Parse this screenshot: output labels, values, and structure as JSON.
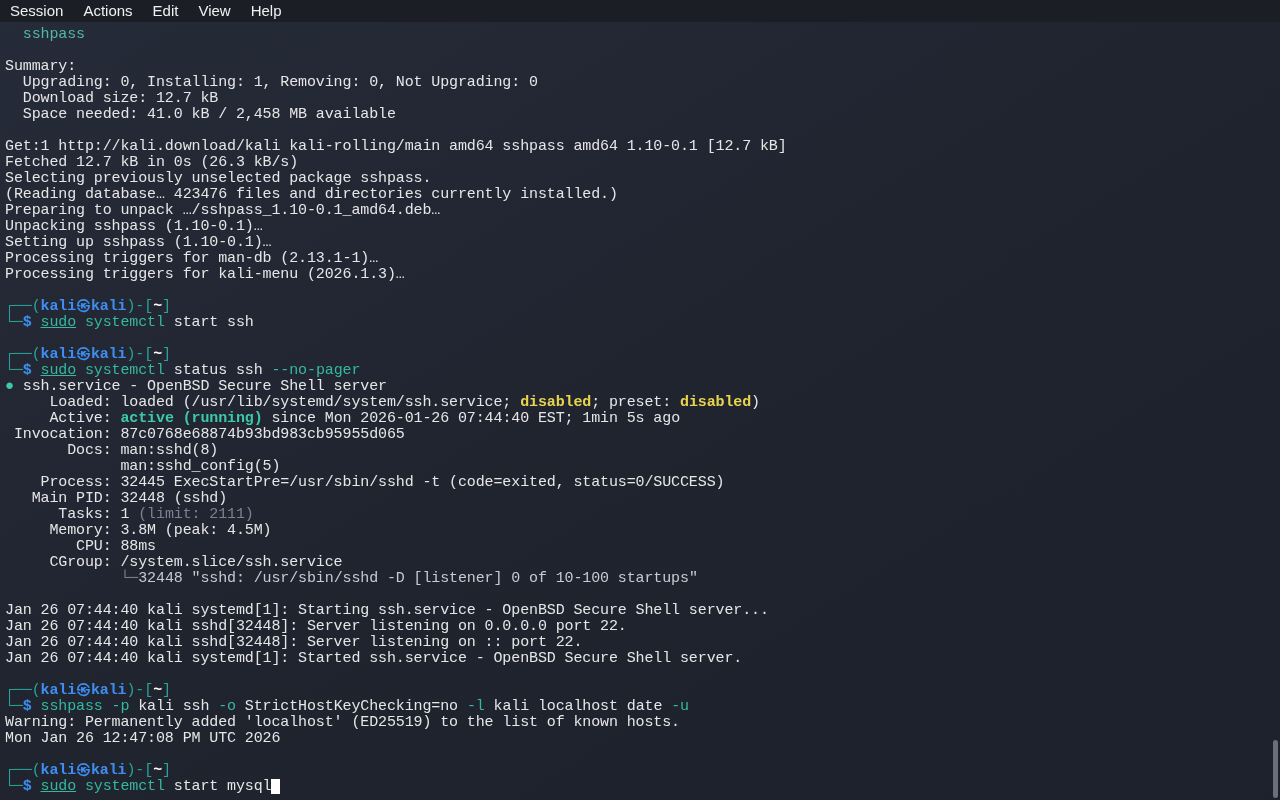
{
  "menu": [
    "Session",
    "Actions",
    "Edit",
    "View",
    "Help"
  ],
  "lines": [
    {
      "kind": "output",
      "segments": [
        {
          "text": "  sshpass",
          "kind": "pkg"
        }
      ]
    },
    {
      "kind": "blank"
    },
    {
      "kind": "output",
      "segments": [
        {
          "text": "Summary:",
          "kind": "plain"
        }
      ]
    },
    {
      "kind": "output",
      "segments": [
        {
          "text": "  Upgrading: 0, Installing: 1, Removing: 0, Not Upgrading: 0",
          "kind": "plain"
        }
      ]
    },
    {
      "kind": "output",
      "segments": [
        {
          "text": "  Download size: 12.7 kB",
          "kind": "plain"
        }
      ]
    },
    {
      "kind": "output",
      "segments": [
        {
          "text": "  Space needed: 41.0 kB / 2,458 MB available",
          "kind": "plain"
        }
      ]
    },
    {
      "kind": "blank"
    },
    {
      "kind": "output",
      "segments": [
        {
          "text": "Get:1 http://kali.download/kali kali-rolling/main amd64 sshpass amd64 1.10-0.1 [12.7 kB]",
          "kind": "plain"
        }
      ]
    },
    {
      "kind": "output",
      "segments": [
        {
          "text": "Fetched 12.7 kB in 0s (26.3 kB/s)",
          "kind": "plain"
        }
      ]
    },
    {
      "kind": "output",
      "segments": [
        {
          "text": "Selecting previously unselected package sshpass.",
          "kind": "plain"
        }
      ]
    },
    {
      "kind": "output",
      "segments": [
        {
          "text": "(Reading database… 423476 files and directories currently installed.)",
          "kind": "plain"
        }
      ]
    },
    {
      "kind": "output",
      "segments": [
        {
          "text": "Preparing to unpack …/sshpass_1.10-0.1_amd64.deb…",
          "kind": "plain"
        }
      ]
    },
    {
      "kind": "output",
      "segments": [
        {
          "text": "Unpacking sshpass (1.10-0.1)…",
          "kind": "plain"
        }
      ]
    },
    {
      "kind": "output",
      "segments": [
        {
          "text": "Setting up sshpass (1.10-0.1)…",
          "kind": "plain"
        }
      ]
    },
    {
      "kind": "output",
      "segments": [
        {
          "text": "Processing triggers for man-db (2.13.1-1)…",
          "kind": "plain"
        }
      ]
    },
    {
      "kind": "output",
      "segments": [
        {
          "text": "Processing triggers for kali-menu (2026.1.3)…",
          "kind": "plain"
        }
      ]
    },
    {
      "kind": "blank"
    },
    {
      "kind": "prompt",
      "segments": [
        {
          "text": "┌──(",
          "kind": "frame"
        },
        {
          "text": "kali㉿kali",
          "kind": "user"
        },
        {
          "text": ")-[",
          "kind": "frame"
        },
        {
          "text": "~",
          "kind": "home"
        },
        {
          "text": "]",
          "kind": "frame"
        }
      ]
    },
    {
      "kind": "command",
      "segments": [
        {
          "text": "└─",
          "kind": "frame"
        },
        {
          "text": "$ ",
          "kind": "user"
        },
        {
          "text": "sudo",
          "kind": "sudo"
        },
        {
          "text": " systemctl",
          "kind": "cmd"
        },
        {
          "text": " start ssh",
          "kind": "plain"
        }
      ]
    },
    {
      "kind": "blank"
    },
    {
      "kind": "prompt",
      "segments": [
        {
          "text": "┌──(",
          "kind": "frame"
        },
        {
          "text": "kali㉿kali",
          "kind": "user"
        },
        {
          "text": ")-[",
          "kind": "frame"
        },
        {
          "text": "~",
          "kind": "home"
        },
        {
          "text": "]",
          "kind": "frame"
        }
      ]
    },
    {
      "kind": "command",
      "segments": [
        {
          "text": "└─",
          "kind": "frame"
        },
        {
          "text": "$ ",
          "kind": "user"
        },
        {
          "text": "sudo",
          "kind": "sudo"
        },
        {
          "text": " systemctl",
          "kind": "cmd"
        },
        {
          "text": " status ssh ",
          "kind": "plain"
        },
        {
          "text": "--no-pager",
          "kind": "cmd"
        }
      ]
    },
    {
      "kind": "output",
      "segments": [
        {
          "text": "●",
          "kind": "ok"
        },
        {
          "text": " ssh.service - OpenBSD Secure Shell server",
          "kind": "plain"
        }
      ]
    },
    {
      "kind": "output",
      "segments": [
        {
          "text": "     Loaded: loaded (/usr/lib/systemd/system/ssh.service; ",
          "kind": "plain"
        },
        {
          "text": "disabled",
          "kind": "warn"
        },
        {
          "text": "; preset: ",
          "kind": "plain"
        },
        {
          "text": "disabled",
          "kind": "warn"
        },
        {
          "text": ")",
          "kind": "plain"
        }
      ]
    },
    {
      "kind": "output",
      "segments": [
        {
          "text": "     Active: ",
          "kind": "plain"
        },
        {
          "text": "active (running)",
          "kind": "okbold"
        },
        {
          "text": " since Mon 2026-01-26 07:44:40 EST; 1min 5s ago",
          "kind": "plain"
        }
      ]
    },
    {
      "kind": "output",
      "segments": [
        {
          "text": " Invocation: 87c0768e68874b93bd983cb95955d065",
          "kind": "plain"
        }
      ]
    },
    {
      "kind": "output",
      "segments": [
        {
          "text": "       Docs: man:sshd(8)",
          "kind": "plain"
        }
      ]
    },
    {
      "kind": "output",
      "segments": [
        {
          "text": "             man:sshd_config(5)",
          "kind": "plain"
        }
      ]
    },
    {
      "kind": "output",
      "segments": [
        {
          "text": "    Process: 32445 ExecStartPre=/usr/sbin/sshd -t (code=exited, status=0/SUCCESS)",
          "kind": "plain"
        }
      ]
    },
    {
      "kind": "output",
      "segments": [
        {
          "text": "   Main PID: 32448 (sshd)",
          "kind": "plain"
        }
      ]
    },
    {
      "kind": "output",
      "segments": [
        {
          "text": "      Tasks: 1 ",
          "kind": "plain"
        },
        {
          "text": "(limit: 2111)",
          "kind": "dim"
        }
      ]
    },
    {
      "kind": "output",
      "segments": [
        {
          "text": "     Memory: 3.8M (peak: 4.5M)",
          "kind": "plain"
        }
      ]
    },
    {
      "kind": "output",
      "segments": [
        {
          "text": "        CPU: 88ms",
          "kind": "plain"
        }
      ]
    },
    {
      "kind": "output",
      "segments": [
        {
          "text": "     CGroup: /system.slice/ssh.service",
          "kind": "plain"
        }
      ]
    },
    {
      "kind": "output",
      "segments": [
        {
          "text": "             └─",
          "kind": "dim"
        },
        {
          "text": "32448 \"sshd: /usr/sbin/sshd -D [listener] 0 of 10-100 startups\"",
          "kind": "soft"
        }
      ]
    },
    {
      "kind": "blank"
    },
    {
      "kind": "output",
      "segments": [
        {
          "text": "Jan 26 07:44:40 kali systemd[1]: Starting ssh.service - OpenBSD Secure Shell server...",
          "kind": "plain"
        }
      ]
    },
    {
      "kind": "output",
      "segments": [
        {
          "text": "Jan 26 07:44:40 kali sshd[32448]: Server listening on 0.0.0.0 port 22.",
          "kind": "plain"
        }
      ]
    },
    {
      "kind": "output",
      "segments": [
        {
          "text": "Jan 26 07:44:40 kali sshd[32448]: Server listening on :: port 22.",
          "kind": "plain"
        }
      ]
    },
    {
      "kind": "output",
      "segments": [
        {
          "text": "Jan 26 07:44:40 kali systemd[1]: Started ssh.service - OpenBSD Secure Shell server.",
          "kind": "plain"
        }
      ]
    },
    {
      "kind": "blank"
    },
    {
      "kind": "prompt",
      "segments": [
        {
          "text": "┌──(",
          "kind": "frame"
        },
        {
          "text": "kali㉿kali",
          "kind": "user"
        },
        {
          "text": ")-[",
          "kind": "frame"
        },
        {
          "text": "~",
          "kind": "home"
        },
        {
          "text": "]",
          "kind": "frame"
        }
      ]
    },
    {
      "kind": "command",
      "segments": [
        {
          "text": "└─",
          "kind": "frame"
        },
        {
          "text": "$ ",
          "kind": "user"
        },
        {
          "text": "sshpass",
          "kind": "cmd"
        },
        {
          "text": " -p",
          "kind": "cmd"
        },
        {
          "text": " kali ssh ",
          "kind": "plain"
        },
        {
          "text": "-o",
          "kind": "cmd"
        },
        {
          "text": " StrictHostKeyChecking=no ",
          "kind": "plain"
        },
        {
          "text": "-l",
          "kind": "cmd"
        },
        {
          "text": " kali localhost date ",
          "kind": "plain"
        },
        {
          "text": "-u",
          "kind": "cmd"
        }
      ]
    },
    {
      "kind": "output",
      "segments": [
        {
          "text": "Warning: Permanently added 'localhost' (ED25519) to the list of known hosts.",
          "kind": "plain"
        }
      ]
    },
    {
      "kind": "output",
      "segments": [
        {
          "text": "Mon Jan 26 12:47:08 PM UTC 2026",
          "kind": "plain"
        }
      ]
    },
    {
      "kind": "blank"
    },
    {
      "kind": "prompt",
      "segments": [
        {
          "text": "┌──(",
          "kind": "frame"
        },
        {
          "text": "kali㉿kali",
          "kind": "user"
        },
        {
          "text": ")-[",
          "kind": "frame"
        },
        {
          "text": "~",
          "kind": "home"
        },
        {
          "text": "]",
          "kind": "frame"
        }
      ]
    },
    {
      "kind": "command",
      "cursor": true,
      "segments": [
        {
          "text": "└─",
          "kind": "frame"
        },
        {
          "text": "$ ",
          "kind": "user"
        },
        {
          "text": "sudo",
          "kind": "sudo"
        },
        {
          "text": " systemctl",
          "kind": "cmd"
        },
        {
          "text": " start mysql",
          "kind": "plain"
        }
      ]
    }
  ]
}
